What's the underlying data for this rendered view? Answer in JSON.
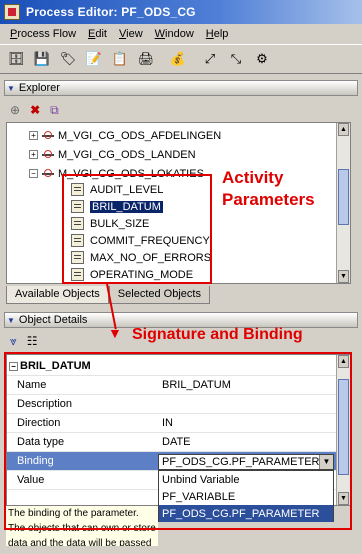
{
  "window": {
    "title": "Process Editor: PF_ODS_CG"
  },
  "menu": [
    {
      "label": "Process Flow",
      "accel": "P"
    },
    {
      "label": "Edit",
      "accel": "E"
    },
    {
      "label": "View",
      "accel": "V"
    },
    {
      "label": "Window",
      "accel": "W"
    },
    {
      "label": "Help",
      "accel": "H"
    }
  ],
  "explorer": {
    "title": "Explorer",
    "tree": {
      "mappings": [
        "M_VGI_CG_ODS_AFDELINGEN",
        "M_VGI_CG_ODS_LANDEN",
        "M_VGI_CG_ODS_LOKATIES"
      ],
      "parameters": [
        "AUDIT_LEVEL",
        "BRIL_DATUM",
        "BULK_SIZE",
        "COMMIT_FREQUENCY",
        "MAX_NO_OF_ERRORS",
        "OPERATING_MODE"
      ],
      "selected_parameter": "BRIL_DATUM"
    },
    "tabs": [
      "Available Objects",
      "Selected Objects"
    ],
    "active_tab": "Available Objects"
  },
  "object_details": {
    "title": "Object Details",
    "object_name": "BRIL_DATUM",
    "properties": [
      {
        "key": "Name",
        "value": "BRIL_DATUM"
      },
      {
        "key": "Description",
        "value": ""
      },
      {
        "key": "Direction",
        "value": "IN"
      },
      {
        "key": "Data type",
        "value": "DATE"
      },
      {
        "key": "Binding",
        "value": ""
      },
      {
        "key": "Value",
        "value": ""
      }
    ],
    "binding_value": "PF_ODS_CG.PF_PARAMETER",
    "binding_options": [
      "Unbind Variable",
      "PF_VARIABLE",
      "PF_ODS_CG.PF_PARAMETER"
    ],
    "binding_selected": "PF_ODS_CG.PF_PARAMETER",
    "description": "The binding of the parameter. The objects that can own or store data and the data will be passed into or out of this parameter, depending on its direction."
  },
  "annotations": {
    "activity_line1": "Activity",
    "activity_line2": "Parameters",
    "signature": "Signature and Binding",
    "color": "#e00000"
  }
}
